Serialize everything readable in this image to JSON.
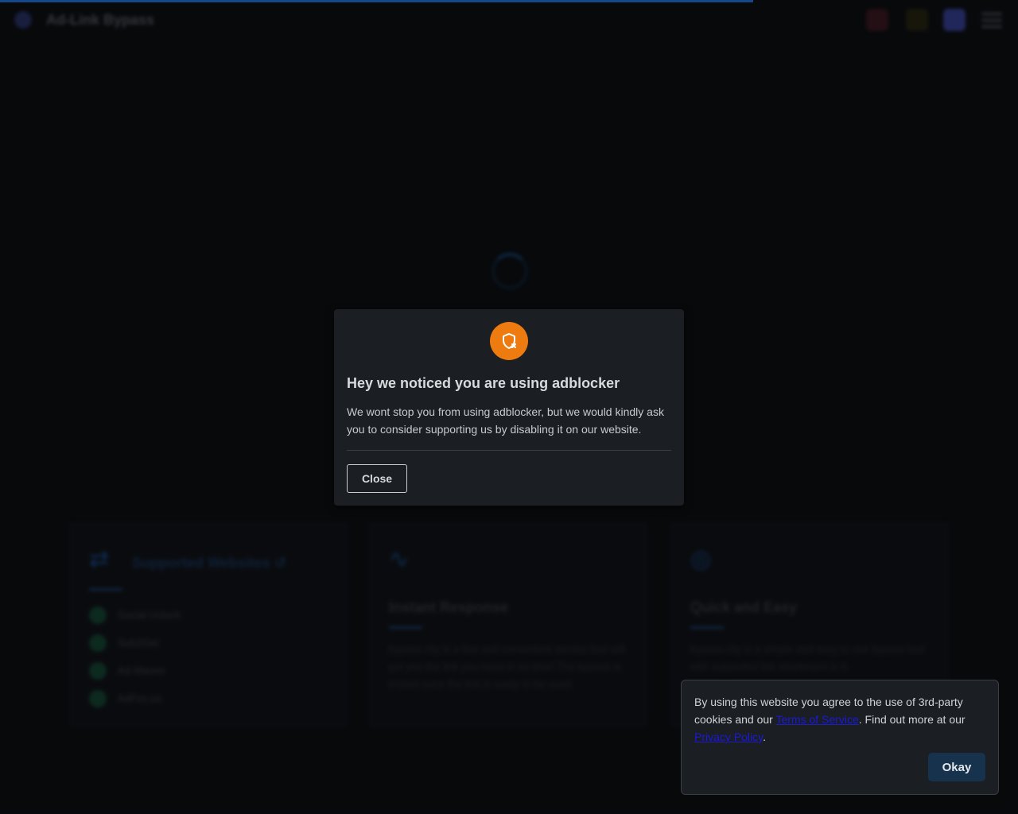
{
  "header": {
    "site_title": "Ad-Link Bypass",
    "icons": [
      "heart-icon",
      "coffee-icon",
      "discord-icon",
      "menu-icon"
    ]
  },
  "progress": {
    "percent": 74
  },
  "cards": [
    {
      "title": "Supported Websites ↺",
      "icon": "link-icon",
      "sites": [
        "Social Unlock",
        "Sub2Get",
        "Ad-Maven",
        "AdFoc.us"
      ]
    },
    {
      "title": "Instant Response",
      "icon": "pulse-icon",
      "text": "bypass.city is a fast and convenient service that will get you the link you need in no time! The bypass is instant once the link is ready to be used."
    },
    {
      "title": "Quick and Easy",
      "icon": "check-circle-icon",
      "text": "bypass.city is a simple and easy to use bypass tool with supported link shorteners in it."
    }
  ],
  "modal": {
    "icon": "shield-x-icon",
    "title": "Hey we noticed you are using adblocker",
    "text": "We wont stop you from using adblocker, but we would kindly ask you to consider supporting us by disabling it on our website.",
    "close_label": "Close"
  },
  "cookie": {
    "text_before": "By using this website you agree to the use of 3rd-party cookies and our ",
    "terms_label": "Terms of Service",
    "text_middle": ". Find out more at our ",
    "privacy_label": "Privacy Policy",
    "text_after": ".",
    "okay_label": "Okay"
  },
  "colors": {
    "accent": "#1f6fd6",
    "modal_icon": "#ee7b10",
    "link": "#1a1ad8"
  }
}
